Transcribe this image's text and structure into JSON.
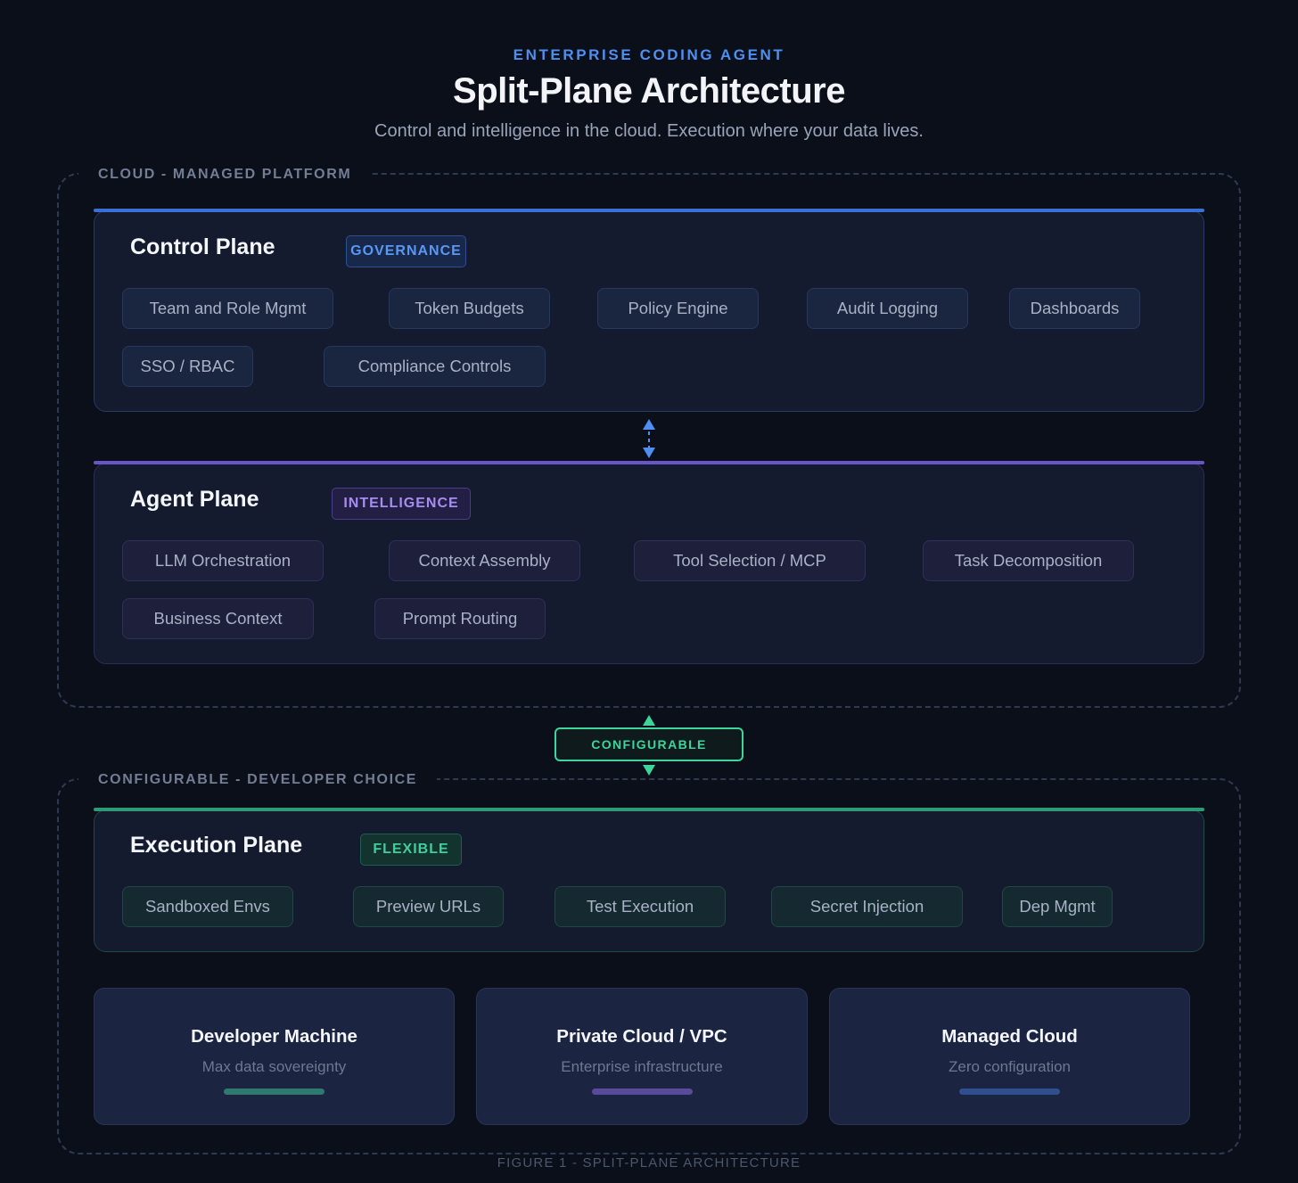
{
  "header": {
    "eyebrow": "ENTERPRISE CODING AGENT",
    "title": "Split-Plane Architecture",
    "subtitle": "Control and intelligence in the cloud. Execution where your data lives."
  },
  "cloud_zone": {
    "label": "CLOUD - MANAGED PLATFORM",
    "control_plane": {
      "title": "Control Plane",
      "badge": "GOVERNANCE",
      "accent": "#3b6fd6",
      "items": [
        "Team and Role Mgmt",
        "Token Budgets",
        "Policy Engine",
        "Audit Logging",
        "Dashboards",
        "SSO / RBAC",
        "Compliance Controls"
      ]
    },
    "agent_plane": {
      "title": "Agent Plane",
      "badge": "INTELLIGENCE",
      "accent": "#6a55c8",
      "items": [
        "LLM Orchestration",
        "Context Assembly",
        "Tool Selection / MCP",
        "Task Decomposition",
        "Business Context",
        "Prompt Routing"
      ]
    }
  },
  "connector": {
    "label": "CONFIGURABLE",
    "color": "#3dd59a"
  },
  "configurable_zone": {
    "label": "CONFIGURABLE - DEVELOPER CHOICE",
    "execution_plane": {
      "title": "Execution Plane",
      "badge": "FLEXIBLE",
      "accent": "#2e9a78",
      "items": [
        "Sandboxed Envs",
        "Preview URLs",
        "Test Execution",
        "Secret Injection",
        "Dep Mgmt"
      ]
    },
    "deployments": [
      {
        "title": "Developer Machine",
        "subtitle": "Max data sovereignty",
        "color": "#2e7a6e"
      },
      {
        "title": "Private Cloud / VPC",
        "subtitle": "Enterprise infrastructure",
        "color": "#5a4a9c"
      },
      {
        "title": "Managed Cloud",
        "subtitle": "Zero configuration",
        "color": "#2f4f8f"
      }
    ]
  },
  "caption": "FIGURE 1 - SPLIT-PLANE ARCHITECTURE"
}
